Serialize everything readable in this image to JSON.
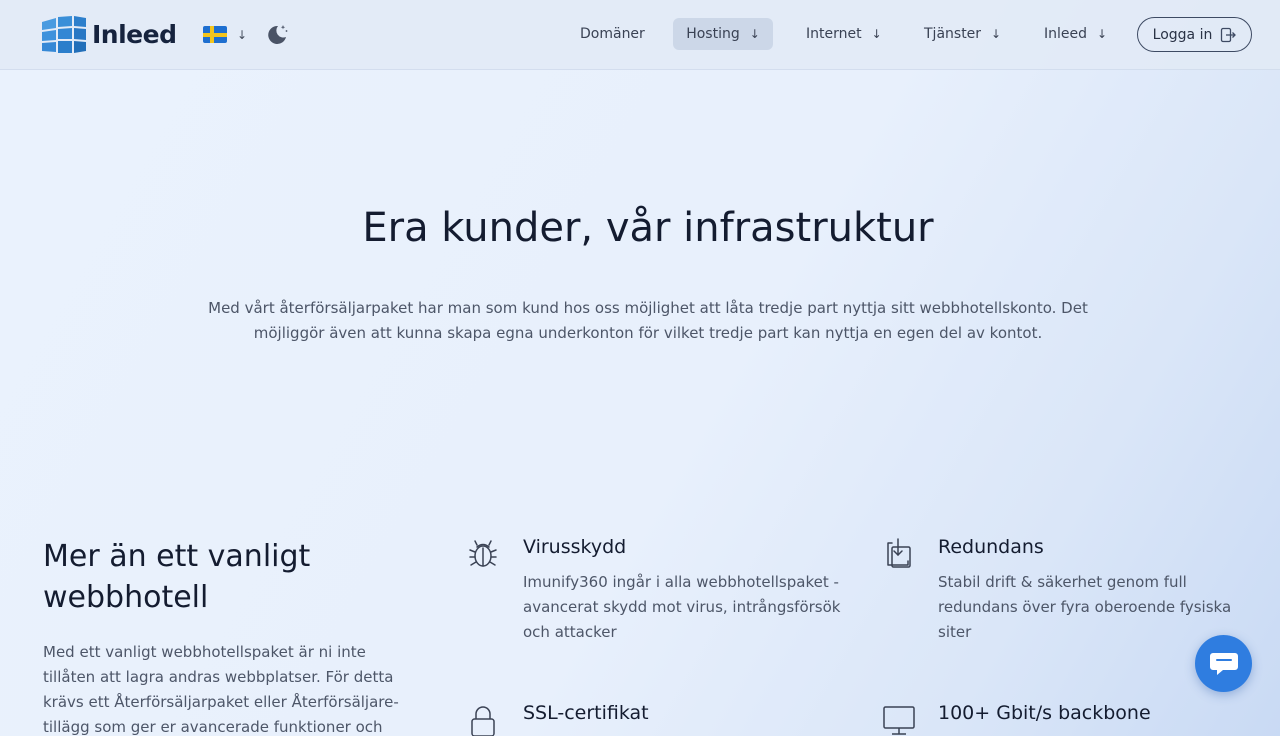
{
  "header": {
    "brand": "Inleed",
    "language_icon": "sweden-flag-icon",
    "theme_icon": "moon-icon",
    "nav": [
      {
        "label": "Domäner",
        "dropdown": false
      },
      {
        "label": "Hosting",
        "dropdown": true,
        "active": true
      },
      {
        "label": "Internet",
        "dropdown": true
      },
      {
        "label": "Tjänster",
        "dropdown": true
      },
      {
        "label": "Inleed",
        "dropdown": true
      }
    ],
    "login_label": "Logga in",
    "dropdown_arrow": "↓"
  },
  "hero": {
    "title": "Era kunder, vår infrastruktur",
    "text": "Med vårt återförsäljarpaket har man som kund hos oss möjlighet att låta tredje part nyttja sitt webbhotellskonto. Det möjliggör även att kunna skapa egna underkonton för vilket tredje part kan nyttja en egen del av kontot."
  },
  "section": {
    "title": "Mer än ett vanligt webbhotell",
    "text": "Med ett vanligt webbhotellspaket är ni inte tillåten att lagra andras webbplatser. För detta krävs ett Återförsäljarpaket eller Återförsäljare-tillägg som ger er avancerade funktioner och"
  },
  "features": [
    {
      "icon": "bug-icon",
      "title": "Virusskydd",
      "desc": "Imunify360 ingår i alla webbhotellspaket - avancerat skydd mot virus, intrångsförsök och attacker"
    },
    {
      "icon": "server-download-icon",
      "title": "Redundans",
      "desc": "Stabil drift & säkerhet genom full redundans över fyra oberoende fysiska siter"
    },
    {
      "icon": "lock-icon",
      "title": "SSL-certifikat",
      "desc": ""
    },
    {
      "icon": "monitor-icon",
      "title": "100+ Gbit/s backbone",
      "desc": ""
    }
  ],
  "colors": {
    "accent": "#2f7de0",
    "brand_blue": "#3a8fd8",
    "text_dark": "#141c30",
    "text_muted": "#4d5668",
    "nav_active_bg": "#ccd7e8"
  },
  "chat_icon": "chat-bubble-icon"
}
